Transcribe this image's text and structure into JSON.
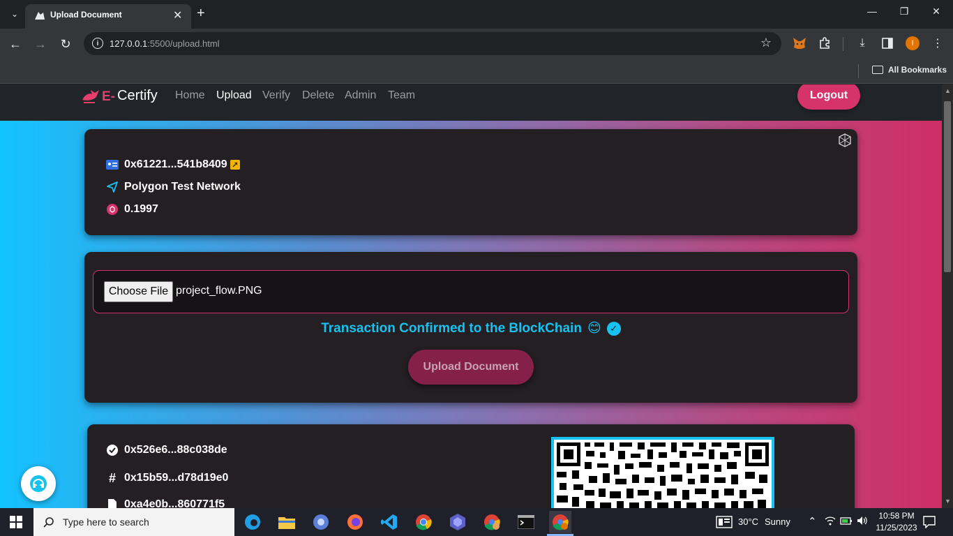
{
  "browser": {
    "tab_title": "Upload Document",
    "tab_close": "✕",
    "new_tab": "+",
    "url_host": "127.0.0.1",
    "url_path": ":5500/upload.html",
    "bookmarks_label": "All Bookmarks",
    "profile_initial": "I"
  },
  "site": {
    "brand_prefix": "E-",
    "brand_name": "Certify",
    "nav": [
      "Home",
      "Upload",
      "Verify",
      "Delete",
      "Admin",
      "Team"
    ],
    "active_nav": "Upload",
    "logout_label": "Logout"
  },
  "account": {
    "address": "0x61221...541b8409",
    "network": "Polygon Test Network",
    "balance": "0.1997"
  },
  "upload": {
    "choose_file_label": "Choose File",
    "file_name": "project_flow.PNG",
    "status_text": "Transaction Confirmed to the BlockChain",
    "status_emoji": "😊",
    "upload_button_label": "Upload Document"
  },
  "result": {
    "tx_hash": "0x526e6...88c038de",
    "doc_hash": "0x15b59...d78d19e0",
    "third_hash": "0xa4e0b...860771f5"
  },
  "taskbar": {
    "search_placeholder": "Type here to search",
    "weather_temp": "30°C",
    "weather_text": "Sunny",
    "time": "10:58 PM",
    "date": "11/25/2023"
  },
  "colors": {
    "accent_pink": "#d7336b",
    "accent_cyan": "#17c2f0",
    "card_bg": "#231f23"
  }
}
